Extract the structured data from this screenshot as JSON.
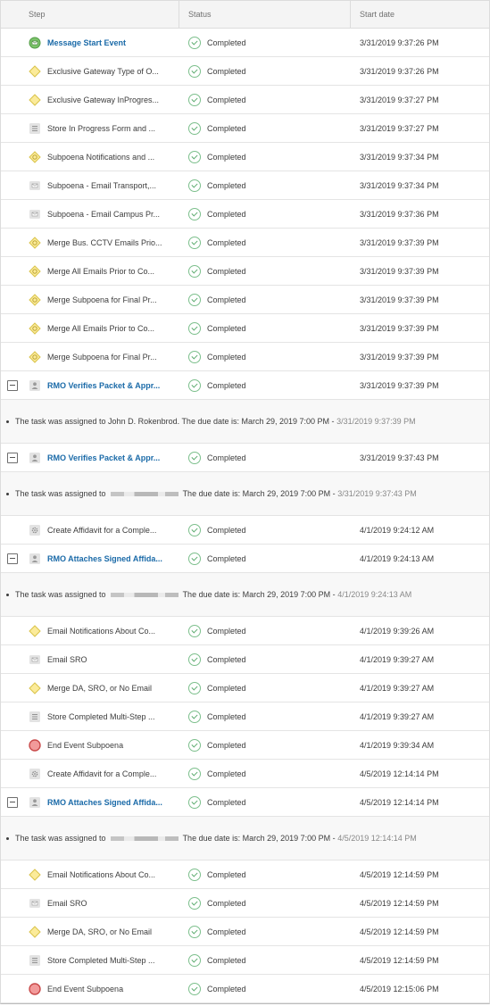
{
  "columns": {
    "step": "Step",
    "status": "Status",
    "start_date": "Start date"
  },
  "rows": [
    {
      "kind": "step",
      "icon": "message-start",
      "label": "Message Start Event",
      "link": true,
      "status": "Completed",
      "date": "3/31/2019 9:37:26 PM"
    },
    {
      "kind": "step",
      "icon": "gateway",
      "label": "Exclusive Gateway Type of O...",
      "status": "Completed",
      "date": "3/31/2019 9:37:26 PM"
    },
    {
      "kind": "step",
      "icon": "gateway",
      "label": "Exclusive Gateway InProgres...",
      "status": "Completed",
      "date": "3/31/2019 9:37:27 PM"
    },
    {
      "kind": "step",
      "icon": "script",
      "label": "Store In Progress Form and ...",
      "status": "Completed",
      "date": "3/31/2019 9:37:27 PM"
    },
    {
      "kind": "step",
      "icon": "parallel-gateway",
      "label": "Subpoena Notifications and ...",
      "status": "Completed",
      "date": "3/31/2019 9:37:34 PM"
    },
    {
      "kind": "step",
      "icon": "email",
      "label": "Subpoena - Email Transport,...",
      "status": "Completed",
      "date": "3/31/2019 9:37:34 PM"
    },
    {
      "kind": "step",
      "icon": "email",
      "label": "Subpoena - Email Campus Pr...",
      "status": "Completed",
      "date": "3/31/2019 9:37:36 PM"
    },
    {
      "kind": "step",
      "icon": "parallel-gateway",
      "label": "Merge Bus. CCTV Emails Prio...",
      "status": "Completed",
      "date": "3/31/2019 9:37:39 PM"
    },
    {
      "kind": "step",
      "icon": "parallel-gateway",
      "label": "Merge All Emails Prior to Co...",
      "status": "Completed",
      "date": "3/31/2019 9:37:39 PM"
    },
    {
      "kind": "step",
      "icon": "parallel-gateway",
      "label": "Merge Subpoena for Final Pr...",
      "status": "Completed",
      "date": "3/31/2019 9:37:39 PM"
    },
    {
      "kind": "step",
      "icon": "parallel-gateway",
      "label": "Merge All Emails Prior to Co...",
      "status": "Completed",
      "date": "3/31/2019 9:37:39 PM"
    },
    {
      "kind": "step",
      "icon": "parallel-gateway",
      "label": "Merge Subpoena for Final Pr...",
      "status": "Completed",
      "date": "3/31/2019 9:37:39 PM"
    },
    {
      "kind": "step",
      "icon": "user-task",
      "label": "RMO Verifies Packet & Appr...",
      "link": true,
      "toggle": true,
      "status": "Completed",
      "date": "3/31/2019 9:37:39 PM"
    },
    {
      "kind": "detail",
      "before": "The task was assigned to John D. Rokenbrod. The due date is: March 29, 2019 7:00 PM -",
      "time": "3/31/2019 9:37:39 PM",
      "redacted": false
    },
    {
      "kind": "step",
      "icon": "user-task",
      "label": "RMO Verifies Packet & Appr...",
      "link": true,
      "toggle": true,
      "status": "Completed",
      "date": "3/31/2019 9:37:43 PM"
    },
    {
      "kind": "detail",
      "before": "The task was assigned to",
      "after": "The due date is: March 29, 2019 7:00 PM -",
      "time": "3/31/2019 9:37:43 PM",
      "redacted": true
    },
    {
      "kind": "step",
      "icon": "service-task",
      "label": "Create Affidavit for a Comple...",
      "status": "Completed",
      "date": "4/1/2019 9:24:12 AM"
    },
    {
      "kind": "step",
      "icon": "user-task",
      "label": "RMO Attaches Signed Affida...",
      "link": true,
      "toggle": true,
      "status": "Completed",
      "date": "4/1/2019 9:24:13 AM"
    },
    {
      "kind": "detail",
      "before": "The task was assigned to",
      "after": "The due date is: March 29, 2019 7:00 PM -",
      "time": "4/1/2019 9:24:13 AM",
      "redacted": true
    },
    {
      "kind": "step",
      "icon": "gateway",
      "label": "Email Notifications About Co...",
      "status": "Completed",
      "date": "4/1/2019 9:39:26 AM"
    },
    {
      "kind": "step",
      "icon": "email",
      "label": "Email SRO",
      "status": "Completed",
      "date": "4/1/2019 9:39:27 AM"
    },
    {
      "kind": "step",
      "icon": "gateway",
      "label": "Merge DA, SRO, or No Email",
      "status": "Completed",
      "date": "4/1/2019 9:39:27 AM"
    },
    {
      "kind": "step",
      "icon": "script",
      "label": "Store Completed Multi-Step ...",
      "status": "Completed",
      "date": "4/1/2019 9:39:27 AM"
    },
    {
      "kind": "step",
      "icon": "end-event",
      "label": "End Event Subpoena",
      "status": "Completed",
      "date": "4/1/2019 9:39:34 AM"
    },
    {
      "kind": "step",
      "icon": "service-task",
      "label": "Create Affidavit for a Comple...",
      "status": "Completed",
      "date": "4/5/2019 12:14:14 PM"
    },
    {
      "kind": "step",
      "icon": "user-task",
      "label": "RMO Attaches Signed Affida...",
      "link": true,
      "toggle": true,
      "status": "Completed",
      "date": "4/5/2019 12:14:14 PM"
    },
    {
      "kind": "detail",
      "before": "The task was assigned to",
      "after": "The due date is: March 29, 2019 7:00 PM -",
      "time": "4/5/2019 12:14:14 PM",
      "redacted": true
    },
    {
      "kind": "step",
      "icon": "gateway",
      "label": "Email Notifications About Co...",
      "status": "Completed",
      "date": "4/5/2019 12:14:59 PM"
    },
    {
      "kind": "step",
      "icon": "email",
      "label": "Email SRO",
      "status": "Completed",
      "date": "4/5/2019 12:14:59 PM"
    },
    {
      "kind": "step",
      "icon": "gateway",
      "label": "Merge DA, SRO, or No Email",
      "status": "Completed",
      "date": "4/5/2019 12:14:59 PM"
    },
    {
      "kind": "step",
      "icon": "script",
      "label": "Store Completed Multi-Step ...",
      "status": "Completed",
      "date": "4/5/2019 12:14:59 PM"
    },
    {
      "kind": "step",
      "icon": "end-event",
      "label": "End Event Subpoena",
      "status": "Completed",
      "date": "4/5/2019 12:15:06 PM"
    }
  ],
  "colors": {
    "link": "#1a6aa8",
    "gateway_fill": "#fbeb9a",
    "gateway_stroke": "#d9c34a",
    "start_fill": "#7cc36b",
    "end_fill": "#f29a9a",
    "end_stroke": "#c94a4a",
    "completed": "#5bab6e"
  }
}
